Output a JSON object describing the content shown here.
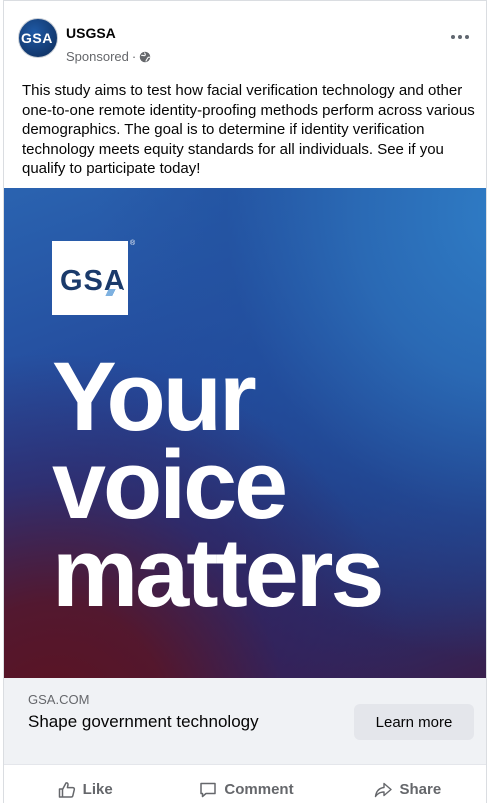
{
  "post": {
    "page_name": "USGSA",
    "avatar_text": "GSA",
    "sponsored_label": "Sponsored",
    "separator": "·",
    "body_text": "This study aims to test how facial verification technology and other one-to-one remote identity-proofing methods perform across various demographics. The goal is to determine if identity verification technology meets equity standards for all individuals. See if you qualify to participate today!"
  },
  "hero": {
    "logo_text": "GSA",
    "registered": "®",
    "headline_lines": [
      "Your",
      "voice",
      "matters"
    ]
  },
  "cta": {
    "domain": "GSA.COM",
    "title": "Shape government technology",
    "button_label": "Learn more"
  },
  "actions": {
    "like_label": "Like",
    "comment_label": "Comment",
    "share_label": "Share"
  },
  "colors": {
    "brand_navy": "#1a3a6b",
    "hero_blue": "#2a63b0",
    "hero_maroon": "#5b1322",
    "cta_background": "#f0f2f5",
    "button_background": "#e4e6eb",
    "secondary_text": "#65676b"
  },
  "icons": {
    "privacy": "globe-icon",
    "more": "more-options-icon",
    "like": "thumbs-up-icon",
    "comment": "comment-bubble-icon",
    "share": "share-arrow-icon"
  }
}
